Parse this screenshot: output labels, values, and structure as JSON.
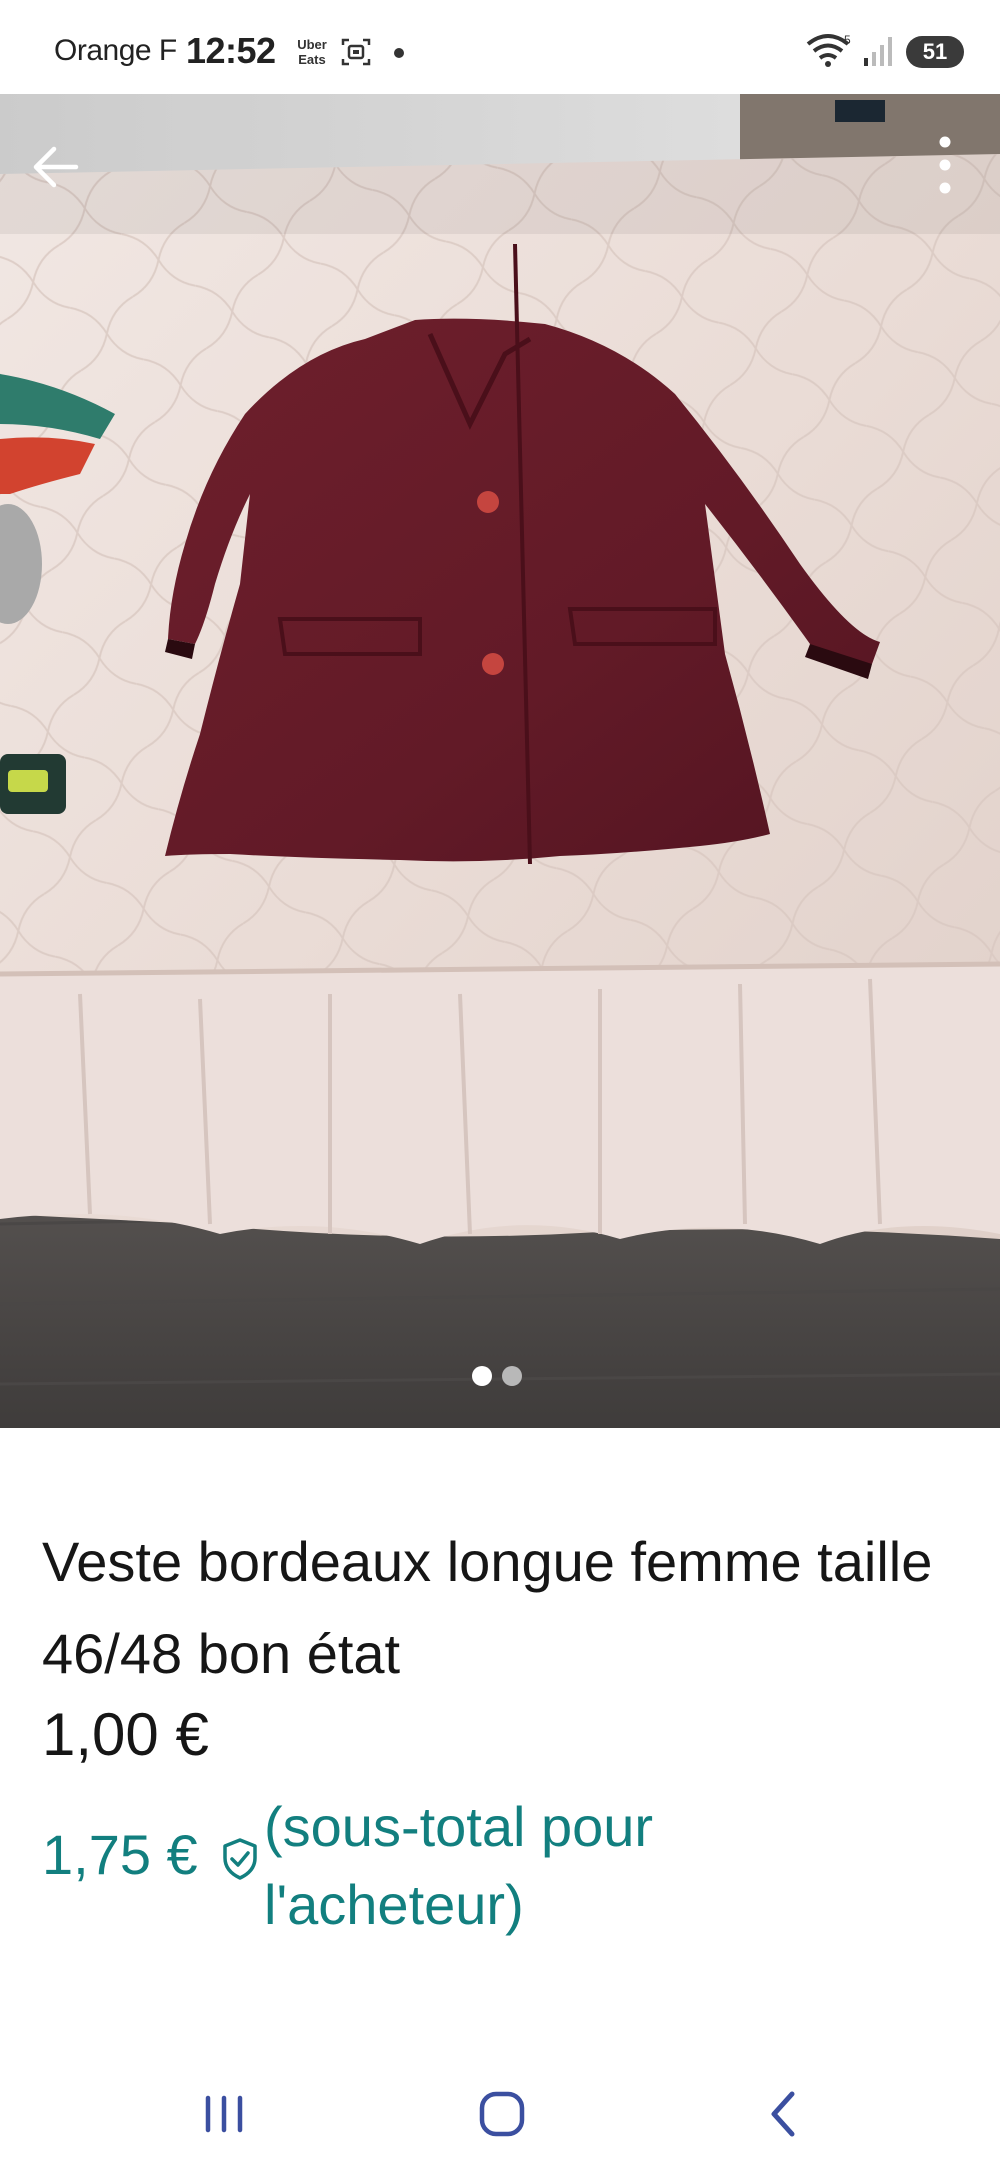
{
  "status_bar": {
    "carrier": "Orange F",
    "time": "12:52",
    "uber_eats_lines": [
      "Uber",
      "Eats"
    ],
    "battery": "51",
    "icons": [
      "uber-eats-icon",
      "screen-record-icon",
      "notification-dot",
      "wifi-icon",
      "signal-icon",
      "battery-icon"
    ]
  },
  "photo": {
    "pages_total": 2,
    "current_page": 1,
    "icons": [
      "back-arrow-icon",
      "more-vertical-icon"
    ]
  },
  "listing": {
    "title": "Veste bordeaux longue femme taille 46/48 bon état",
    "price": "1,00 €",
    "buyer_price": "1,75 €",
    "buyer_note": "(sous-total pour l'acheteur)"
  },
  "nav_bar": {
    "icons": [
      "recent-apps-icon",
      "home-icon",
      "back-icon"
    ]
  },
  "colors": {
    "teal": "#127f7f",
    "text": "#161616",
    "garment": "#6e1f2c",
    "bedspread": "#e9ddd8"
  }
}
